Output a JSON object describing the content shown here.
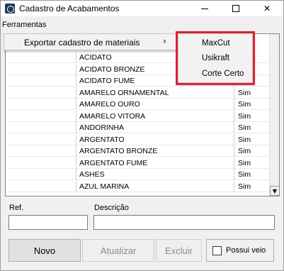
{
  "window": {
    "title": "Cadastro de Acabamentos",
    "controls": {
      "minimize": "min",
      "maximize": "max",
      "close": "✕"
    }
  },
  "menubar": {
    "ferramentas": "Ferramentas"
  },
  "context_menu": {
    "item_label": "Exportar cadastro de materiais",
    "arrow": "›",
    "submenu": [
      "MaxCut",
      "Usikraft",
      "Corte Certo"
    ],
    "highlight_color": "#d9252f"
  },
  "grid": {
    "rows": [
      {
        "desc": "ACIDATO",
        "sim": ""
      },
      {
        "desc": "ACIDATO BRONZE",
        "sim": ""
      },
      {
        "desc": "ACIDATO FUME",
        "sim": "Sim"
      },
      {
        "desc": "AMARELO ORNAMENTAL",
        "sim": "Sim"
      },
      {
        "desc": "AMARELO OURO",
        "sim": "Sim"
      },
      {
        "desc": "AMARELO VITORA",
        "sim": "Sim"
      },
      {
        "desc": "ANDORINHA",
        "sim": "Sim"
      },
      {
        "desc": "ARGENTATO",
        "sim": "Sim"
      },
      {
        "desc": "ARGENTATO BRONZE",
        "sim": "Sim"
      },
      {
        "desc": "ARGENTATO FUME",
        "sim": "Sim"
      },
      {
        "desc": "ASHES",
        "sim": "Sim"
      },
      {
        "desc": "AZUL MARINA",
        "sim": "Sim"
      }
    ],
    "scroll_down_icon": "▼"
  },
  "form": {
    "ref_label": "Ref.",
    "ref_value": "",
    "descricao_label": "Descrição",
    "descricao_value": ""
  },
  "buttons": {
    "novo": "Novo",
    "atualizar": "Atualizar",
    "excluir": "Excluir",
    "possui_veio": "Possui veio"
  }
}
